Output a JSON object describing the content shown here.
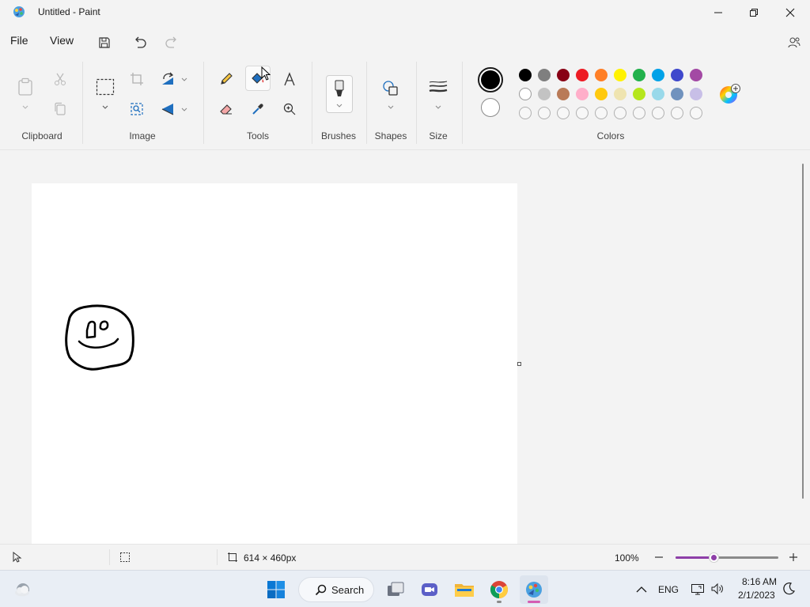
{
  "window": {
    "title": "Untitled - Paint",
    "app_icon": "paint-palette-icon"
  },
  "menu": {
    "file": "File",
    "view": "View"
  },
  "ribbon": {
    "groups": {
      "clipboard": "Clipboard",
      "image": "Image",
      "tools": "Tools",
      "brushes": "Brushes",
      "shapes": "Shapes",
      "size": "Size",
      "colors": "Colors"
    },
    "active_tool": "fill",
    "primary_color": "#000000",
    "secondary_color": "#ffffff",
    "palette_row1": [
      "#000000",
      "#7f7f7f",
      "#880015",
      "#ed1c24",
      "#ff7f27",
      "#fff200",
      "#22b14c",
      "#00a2e8",
      "#3f48cc",
      "#a349a4"
    ],
    "palette_row2": [
      "#ffffff",
      "#c3c3c3",
      "#b97a57",
      "#ffaec9",
      "#ffc90e",
      "#efe4b0",
      "#b5e61d",
      "#99d9ea",
      "#7092be",
      "#c8bfe7"
    ],
    "palette_row3_empty_slots": 10
  },
  "canvas": {
    "drawing": "smiley-face-sketch"
  },
  "status": {
    "canvas_size": "614 × 460px",
    "zoom": "100%",
    "zoom_level_fraction": 0.38
  },
  "taskbar": {
    "search_label": "Search",
    "language": "ENG",
    "time": "8:16 AM",
    "date": "2/1/2023"
  },
  "colors": {
    "accent": "#8e3fa8",
    "windows_blue": "#0078d4"
  }
}
